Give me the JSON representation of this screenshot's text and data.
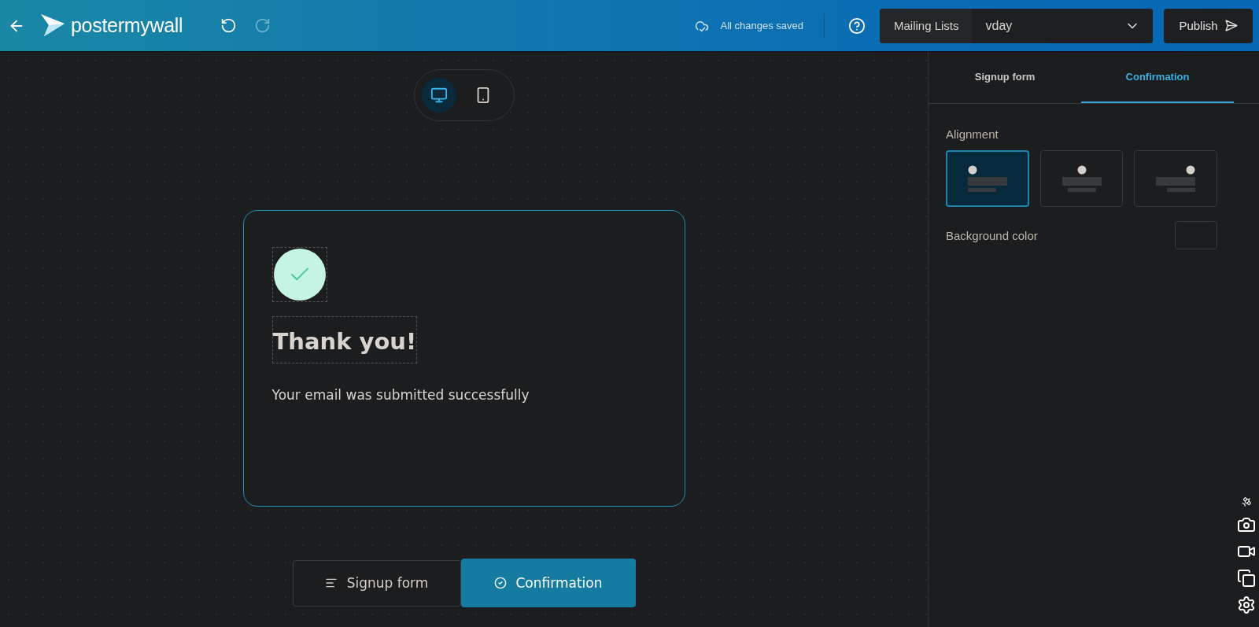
{
  "header": {
    "logo": "postermywall",
    "save_status": "All changes saved",
    "mailing_label": "Mailing Lists",
    "mailing_value": "vday",
    "publish": "Publish"
  },
  "device_toggle": [
    {
      "kind": "desktop",
      "selected": true
    },
    {
      "kind": "mobile",
      "selected": false
    }
  ],
  "card": {
    "title": "Thank you!",
    "message": "Your email was submitted successfully"
  },
  "bottom_tabs": [
    {
      "kind": "list",
      "label": "Signup form",
      "selected": false
    },
    {
      "kind": "check",
      "label": "Confirmation",
      "selected": true
    }
  ],
  "sidebar": {
    "tabs": [
      {
        "label": "Signup form",
        "selected": false
      },
      {
        "label": "Confirmation",
        "selected": true
      }
    ],
    "alignment_label": "Alignment",
    "alignments": [
      {
        "kind": "left",
        "selected": true
      },
      {
        "kind": "center",
        "selected": false
      },
      {
        "kind": "right",
        "selected": false
      }
    ],
    "background_label": "Background color"
  }
}
